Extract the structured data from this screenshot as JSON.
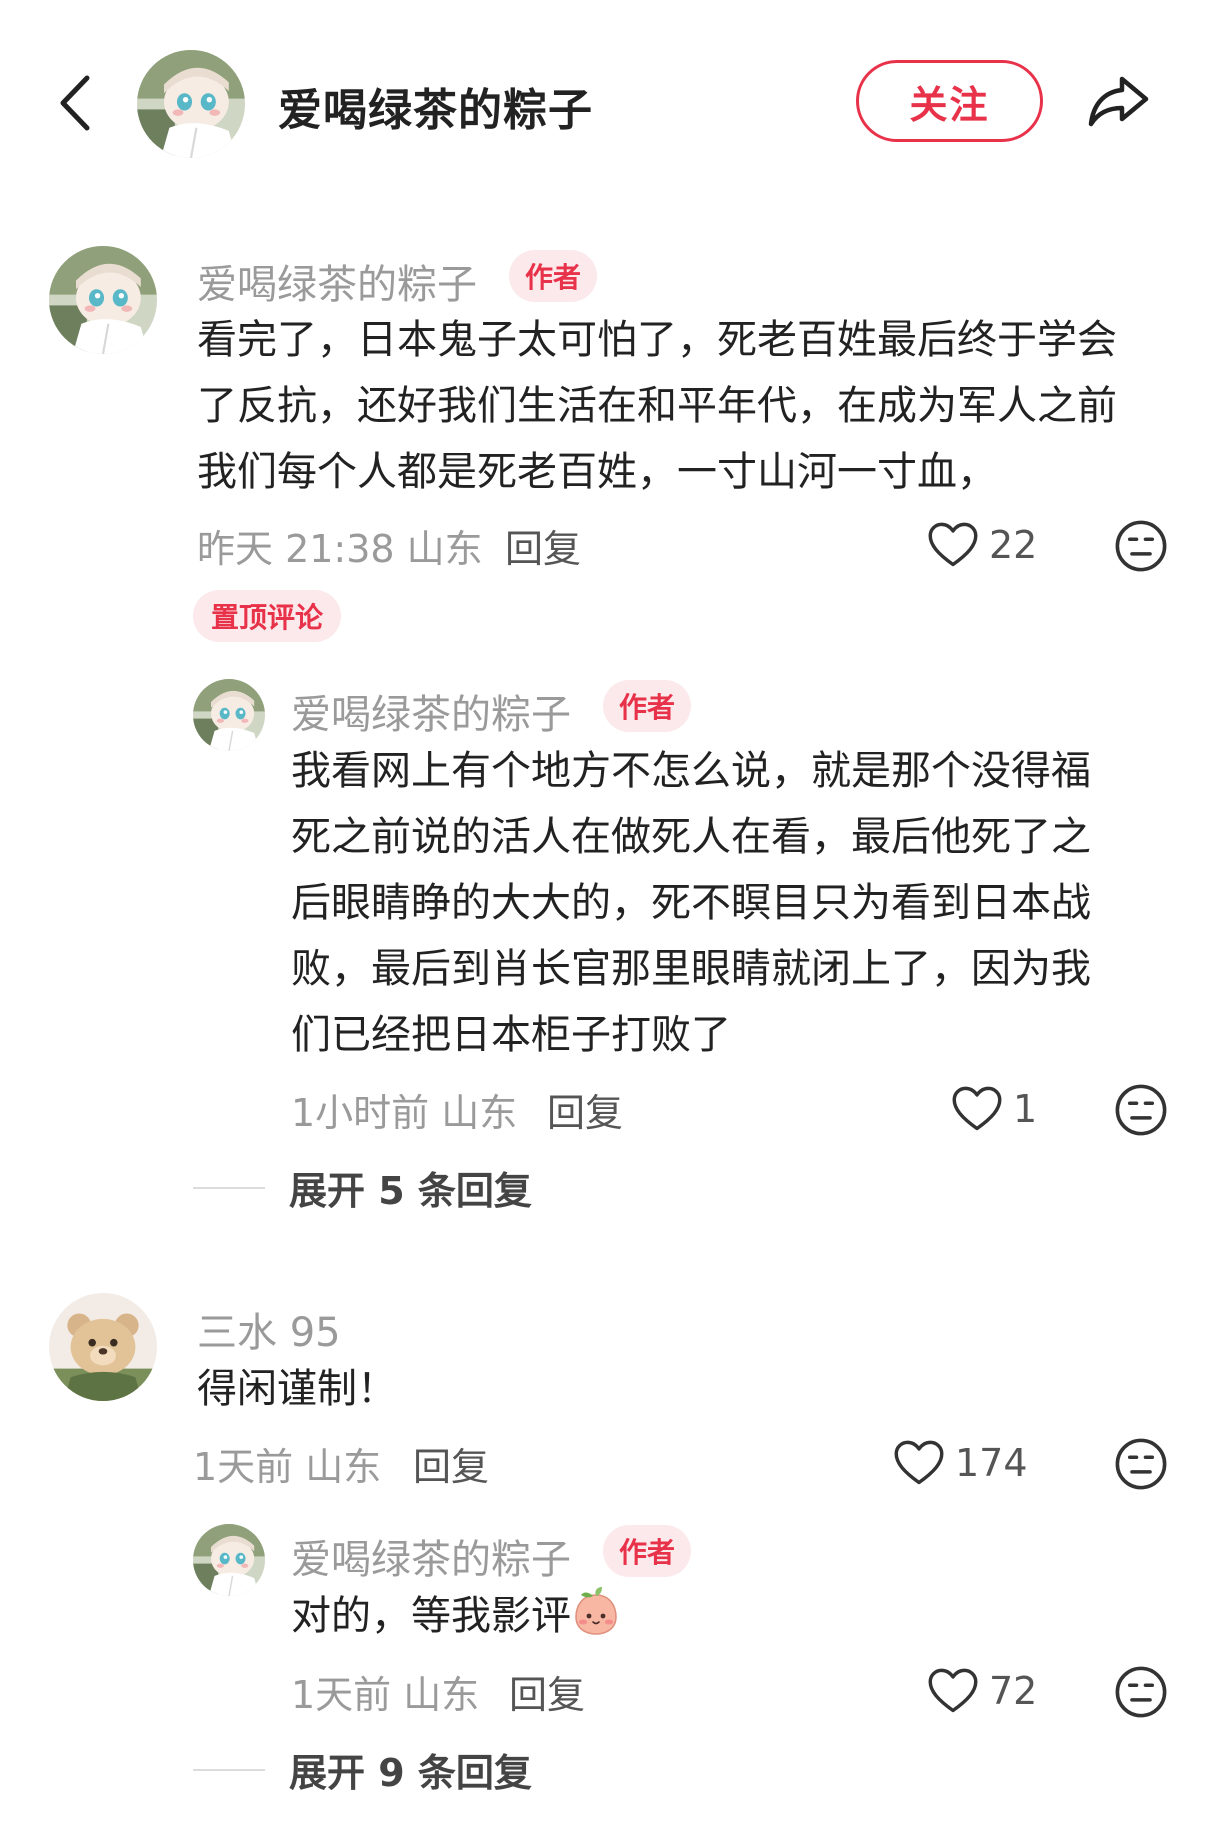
{
  "header": {
    "title": "爱喝绿茶的粽子",
    "follow_label": "关注"
  },
  "colors": {
    "accent": "#e8324a",
    "tag_bg": "#fbe9eb",
    "meta_gray": "#9a9a9a"
  },
  "comments": [
    {
      "username": "爱喝绿茶的粽子",
      "author_tag": "作者",
      "text_lines": [
        "看完了，日本鬼子太可怕了，死老百姓最后终于学会",
        "了反抗，还好我们生活在和平年代，在成为军人之前",
        "我们每个人都是死老百姓，一寸山河一寸血，"
      ],
      "time_location": "昨天 21:38 山东",
      "reply_label": "回复",
      "likes": "22",
      "pinned_label": "置顶评论",
      "replies": [
        {
          "username": "爱喝绿茶的粽子",
          "author_tag": "作者",
          "text_lines": [
            "我看网上有个地方不怎么说，就是那个没得福",
            "死之前说的活人在做死人在看，最后他死了之",
            "后眼睛睁的大大的，死不瞑目只为看到日本战",
            "败，最后到肖长官那里眼睛就闭上了，因为我",
            "们已经把日本柜子打败了"
          ],
          "time_location": "1小时前 山东",
          "reply_label": "回复",
          "likes": "1"
        }
      ],
      "expand_label": "展开 5 条回复"
    },
    {
      "username": "三水 95",
      "text_lines": [
        "得闲谨制！"
      ],
      "time_location": "1天前 山东",
      "reply_label": "回复",
      "likes": "174",
      "replies": [
        {
          "username": "爱喝绿茶的粽子",
          "author_tag": "作者",
          "text_lines": [
            "对的，等我影评"
          ],
          "time_location": "1天前 山东",
          "reply_label": "回复",
          "likes": "72"
        }
      ],
      "expand_label": "展开 9 条回复"
    }
  ],
  "icons": {
    "back": "chevron-left-icon",
    "share": "share-arrow-icon",
    "like": "heart-outline-icon",
    "emoji": "neutral-face-icon",
    "inline_emoji": "peach-face-emoji"
  }
}
